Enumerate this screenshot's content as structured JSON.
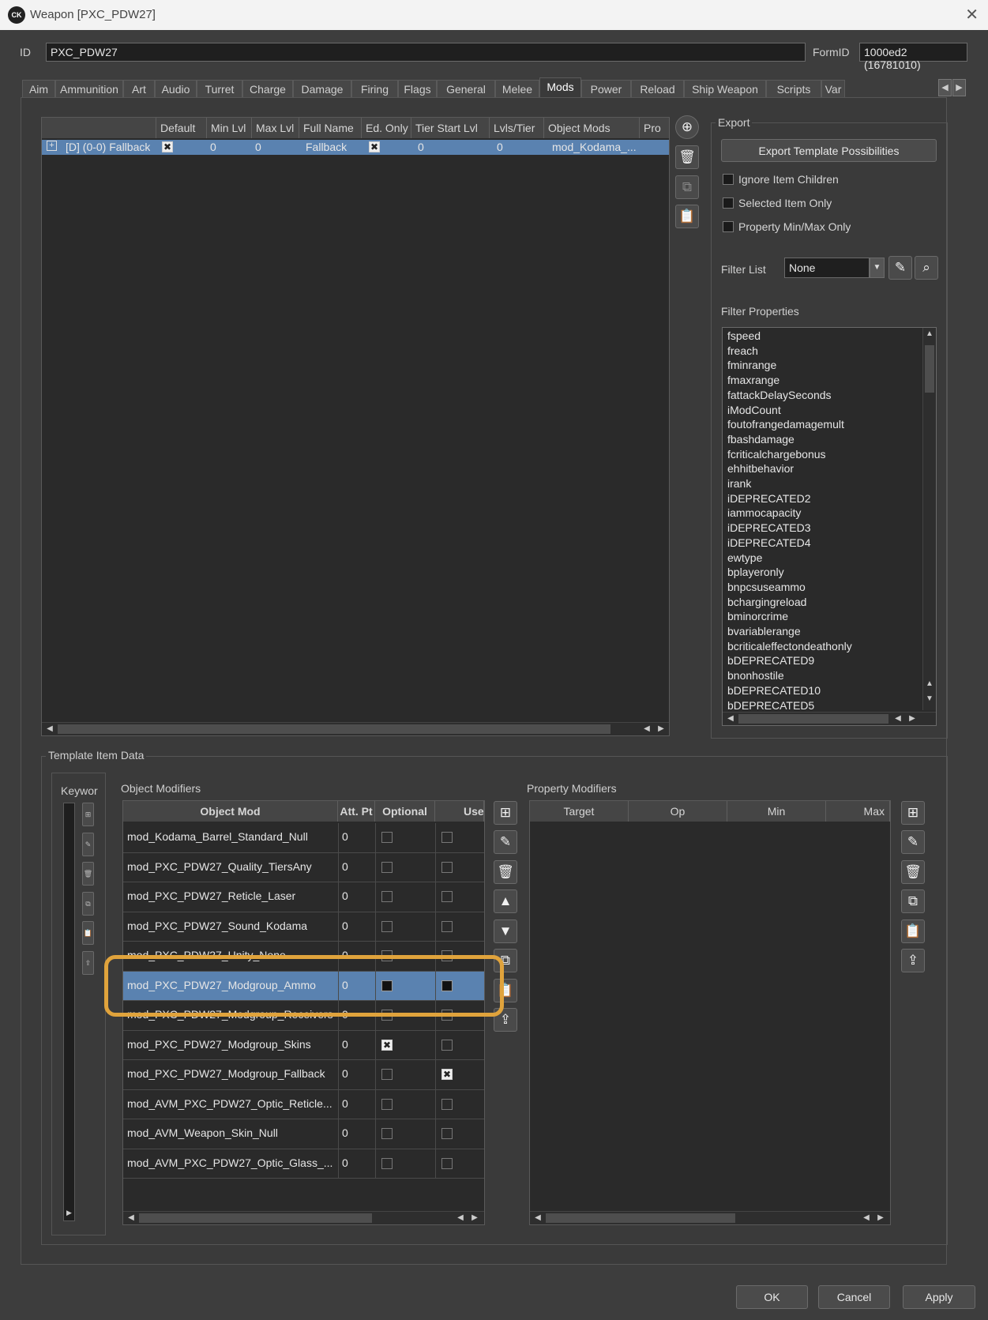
{
  "window": {
    "title": "Weapon [PXC_PDW27]",
    "logo_text": "CK",
    "close_glyph": "✕"
  },
  "id_row": {
    "id_label": "ID",
    "id_value": "PXC_PDW27",
    "formid_label": "FormID",
    "formid_value": "1000ed2  (16781010)"
  },
  "tabs": [
    "Aim",
    "Ammunition",
    "Art",
    "Audio",
    "Turret",
    "Charge",
    "Damage",
    "Firing",
    "Flags",
    "General",
    "Melee",
    "Mods",
    "Power",
    "Reload",
    "Ship Weapon",
    "Scripts",
    "Var"
  ],
  "active_tab": "Mods",
  "templates": {
    "columns": [
      "Default",
      "Min Lvl",
      "Max Lvl",
      "Full Name",
      "Ed. Only",
      "Tier Start Lvl",
      "Lvls/Tier",
      "Object Mods",
      "Pro"
    ],
    "row": {
      "expander": "+",
      "name": "[D] (0-0) Fallback",
      "min_lvl": "0",
      "max_lvl": "0",
      "full_name": "Fallback",
      "tier_start": "0",
      "lvls_tier": "0",
      "object_mods": "mod_Kodama_..."
    }
  },
  "export": {
    "group_label": "Export",
    "button": "Export Template Possibilities",
    "options": [
      "Ignore Item Children",
      "Selected Item Only",
      "Property Min/Max Only"
    ],
    "filter_list_label": "Filter List",
    "filter_list_value": "None",
    "filter_properties_label": "Filter Properties",
    "filter_properties": [
      "fspeed",
      "freach",
      "fminrange",
      "fmaxrange",
      "fattackDelaySeconds",
      "iModCount",
      "foutofrangedamagemult",
      "fbashdamage",
      "fcriticalchargebonus",
      "ehhitbehavior",
      "irank",
      "iDEPRECATED2",
      "iammocapacity",
      "iDEPRECATED3",
      "iDEPRECATED4",
      "ewtype",
      "bplayeronly",
      "bnpcsuseammo",
      "bchargingreload",
      "bminorcrime",
      "bvariablerange",
      "bcriticaleffectondeathonly",
      "bDEPRECATED9",
      "bnonhostile",
      "bDEPRECATED10",
      "bDEPRECATED5"
    ]
  },
  "template_item_data": {
    "group_label": "Template Item Data",
    "keywords_label": "Keywor",
    "object_modifiers_label": "Object Modifiers",
    "om_columns": [
      "Object Mod",
      "Att. Pt",
      "Optional",
      "Use"
    ],
    "object_mods": [
      {
        "name": "mod_Kodama_Barrel_Standard_Null",
        "att": "0",
        "optional": "off",
        "use": "off"
      },
      {
        "name": "mod_PXC_PDW27_Quality_TiersAny",
        "att": "0",
        "optional": "off",
        "use": "off"
      },
      {
        "name": "mod_PXC_PDW27_Reticle_Laser",
        "att": "0",
        "optional": "off",
        "use": "off"
      },
      {
        "name": "mod_PXC_PDW27_Sound_Kodama",
        "att": "0",
        "optional": "off",
        "use": "off"
      },
      {
        "name": "mod_PXC_PDW27_Unity_None",
        "att": "0",
        "optional": "off",
        "use": "off"
      },
      {
        "name": "mod_PXC_PDW27_Modgroup_Ammo",
        "att": "0",
        "optional": "filled",
        "use": "filled"
      },
      {
        "name": "mod_PXC_PDW27_Modgroup_Receivers",
        "att": "0",
        "optional": "off",
        "use": "off"
      },
      {
        "name": "mod_PXC_PDW27_Modgroup_Skins",
        "att": "0",
        "optional": "x",
        "use": "off"
      },
      {
        "name": "mod_PXC_PDW27_Modgroup_Fallback",
        "att": "0",
        "optional": "off",
        "use": "x"
      },
      {
        "name": "mod_AVM_PXC_PDW27_Optic_Reticle...",
        "att": "0",
        "optional": "off",
        "use": "off"
      },
      {
        "name": "mod_AVM_Weapon_Skin_Null",
        "att": "0",
        "optional": "off",
        "use": "off"
      },
      {
        "name": "mod_AVM_PXC_PDW27_Optic_Glass_...",
        "att": "0",
        "optional": "off",
        "use": "off"
      }
    ],
    "selected_row": 5,
    "property_modifiers_label": "Property Modifiers",
    "pm_columns": [
      "Target",
      "Op",
      "Min",
      "Max"
    ]
  },
  "footer": {
    "ok": "OK",
    "cancel": "Cancel",
    "apply": "Apply"
  },
  "colors": {
    "selection": "#5a82b0",
    "highlight": "#e0a33c"
  }
}
